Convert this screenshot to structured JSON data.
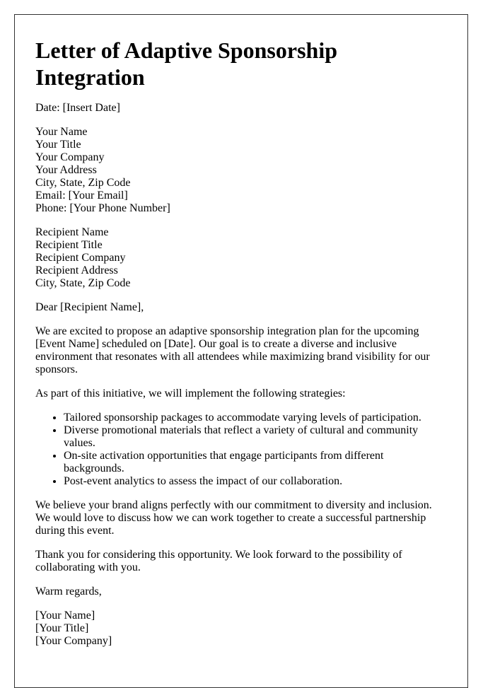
{
  "title": "Letter of Adaptive Sponsorship Integration",
  "date_line": "Date: [Insert Date]",
  "sender": [
    "Your Name",
    "Your Title",
    "Your Company",
    "Your Address",
    "City, State, Zip Code",
    "Email: [Your Email]",
    "Phone: [Your Phone Number]"
  ],
  "recipient": [
    "Recipient Name",
    "Recipient Title",
    "Recipient Company",
    "Recipient Address",
    "City, State, Zip Code"
  ],
  "salutation": "Dear [Recipient Name],",
  "paragraphs": {
    "intro": "We are excited to propose an adaptive sponsorship integration plan for the upcoming [Event Name] scheduled on [Date]. Our goal is to create a diverse and inclusive environment that resonates with all attendees while maximizing brand visibility for our sponsors.",
    "strategies_intro": "As part of this initiative, we will implement the following strategies:",
    "alignment": "We believe your brand aligns perfectly with our commitment to diversity and inclusion. We would love to discuss how we can work together to create a successful partnership during this event.",
    "thanks": "Thank you for considering this opportunity. We look forward to the possibility of collaborating with you."
  },
  "strategies": [
    "Tailored sponsorship packages to accommodate varying levels of participation.",
    "Diverse promotional materials that reflect a variety of cultural and community values.",
    "On-site activation opportunities that engage participants from different backgrounds.",
    "Post-event analytics to assess the impact of our collaboration."
  ],
  "closing": "Warm regards,",
  "signature": [
    "[Your Name]",
    "[Your Title]",
    "[Your Company]"
  ]
}
